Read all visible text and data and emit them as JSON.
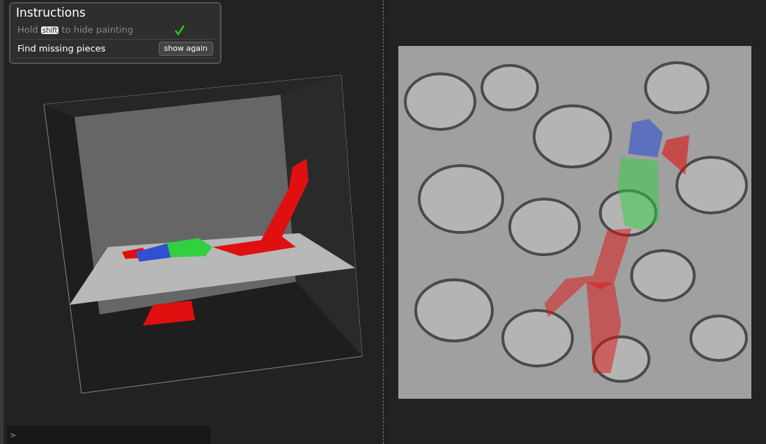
{
  "instructions": {
    "title": "Instructions",
    "tasks": [
      {
        "text": "Hold",
        "key": "shift",
        "text_after": "to hide painting",
        "done": true
      },
      {
        "text": "Find missing pieces",
        "button": "show again",
        "done": false
      }
    ]
  },
  "segments": [
    {
      "color": "#e01010"
    },
    {
      "color": "#30d040"
    },
    {
      "color": "#3050d0"
    }
  ],
  "console": {
    "prompt": ">"
  }
}
